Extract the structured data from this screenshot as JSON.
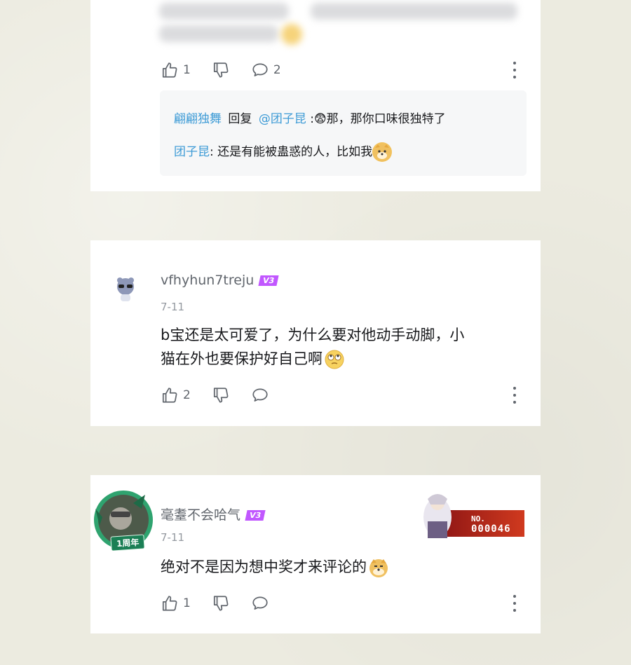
{
  "comments": [
    {
      "actions": {
        "like_count": "1",
        "reply_count": "2"
      },
      "replies": [
        {
          "user": "翩翩独舞",
          "reply_word": "回复",
          "mention": "@团子昆",
          "text": ":😨那，那你口味很独特了"
        },
        {
          "user": "团子昆",
          "text": ": 还是有能被蛊惑的人，比如我",
          "emoji": "doge-icon"
        }
      ]
    },
    {
      "username": "vfhyhun7treju",
      "level": "V3",
      "date": "7-11",
      "content_line1": "b宝还是太可爱了，为什么要对他动手动脚，小",
      "content_line2": "猫在外也要保护好自己啊",
      "content_emoji": "rolling-eyes-icon",
      "actions": {
        "like_count": "2"
      }
    },
    {
      "username": "毫耋不会哈气",
      "level": "V3",
      "date": "7-11",
      "content": "绝对不是因为想中奖才来评论的",
      "content_emoji": "doge-icon",
      "avatar_badge": "1周年",
      "card_badge": {
        "label": "NO.",
        "number": "000046"
      },
      "actions": {
        "like_count": "1"
      }
    }
  ],
  "colors": {
    "background": "#ecebe0",
    "link_blue": "#3d9bd6",
    "level_purple": "#c157ff",
    "icon_gray": "#61666d",
    "date_gray": "#9499a0"
  }
}
